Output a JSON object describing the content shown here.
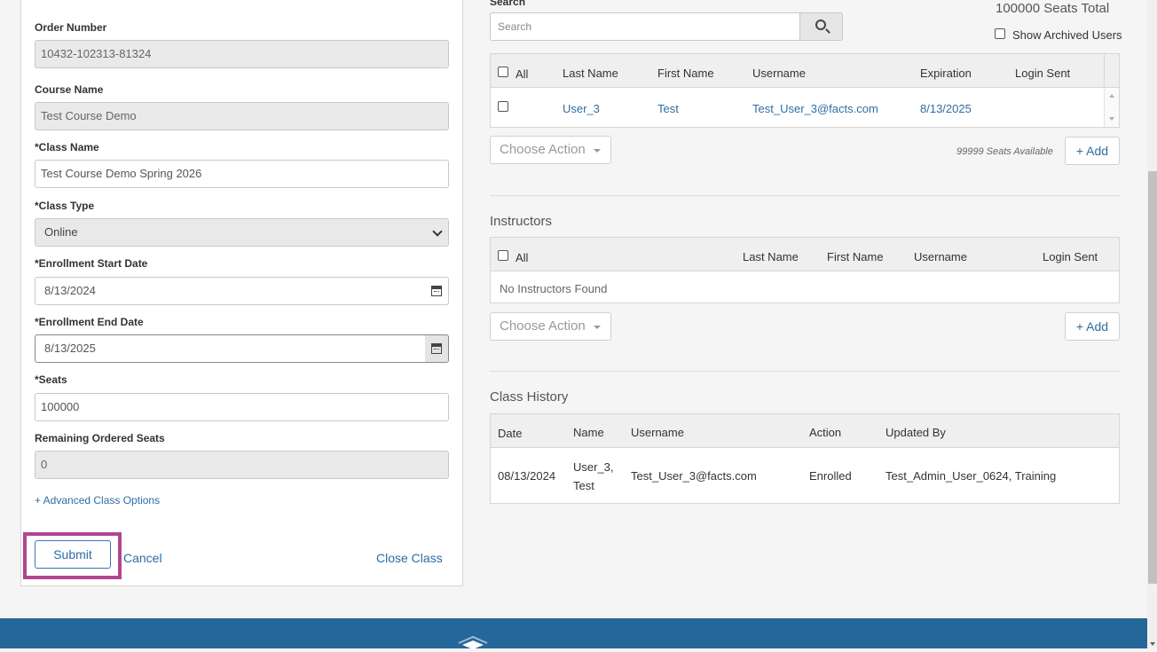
{
  "form": {
    "order_number_label": "Order Number",
    "order_number_value": "10432-102313-81324",
    "course_name_label": "Course Name",
    "course_name_value": "Test Course Demo",
    "class_name_label": "*Class Name",
    "class_name_value": "Test Course Demo Spring 2026",
    "class_type_label": "*Class Type",
    "class_type_value": "Online",
    "enroll_start_label": "*Enrollment Start Date",
    "enroll_start_value": "8/13/2024",
    "enroll_end_label": "*Enrollment End Date",
    "enroll_end_value": "8/13/2025",
    "seats_label": "*Seats",
    "seats_value": "100000",
    "remaining_label": "Remaining Ordered Seats",
    "remaining_value": "0",
    "advanced_link": "+ Advanced Class Options",
    "submit_label": "Submit",
    "cancel_label": "Cancel",
    "close_label": "Close Class"
  },
  "students": {
    "search_label": "Search",
    "search_placeholder": "Search",
    "seats_total": "100000 Seats Total",
    "show_archived": "Show Archived Users",
    "headers": {
      "all": "All",
      "last": "Last Name",
      "first": "First Name",
      "username": "Username",
      "expiration": "Expiration",
      "login": "Login Sent"
    },
    "rows": [
      {
        "last": "User_3",
        "first": "Test",
        "username": "Test_User_3@facts.com",
        "expiration": "8/13/2025",
        "login": ""
      }
    ],
    "choose_action": "Choose Action",
    "seats_available": "99999 Seats Available",
    "add": "+ Add"
  },
  "instructors": {
    "title": "Instructors",
    "headers": {
      "all": "All",
      "last": "Last Name",
      "first": "First Name",
      "username": "Username",
      "login": "Login Sent"
    },
    "empty": "No Instructors Found",
    "choose_action": "Choose Action",
    "add": "+ Add"
  },
  "history": {
    "title": "Class History",
    "headers": {
      "date": "Date",
      "name": "Name",
      "username": "Username",
      "action": "Action",
      "updated_by": "Updated By"
    },
    "rows": [
      {
        "date": "08/13/2024",
        "name_line1": "User_3,",
        "name_line2": "Test",
        "username": "Test_User_3@facts.com",
        "action": "Enrolled",
        "updated_by": "Test_Admin_User_0624, Training"
      }
    ]
  },
  "colors": {
    "accent": "#2d6da3",
    "highlight": "#b1468f",
    "footer": "#256799"
  }
}
